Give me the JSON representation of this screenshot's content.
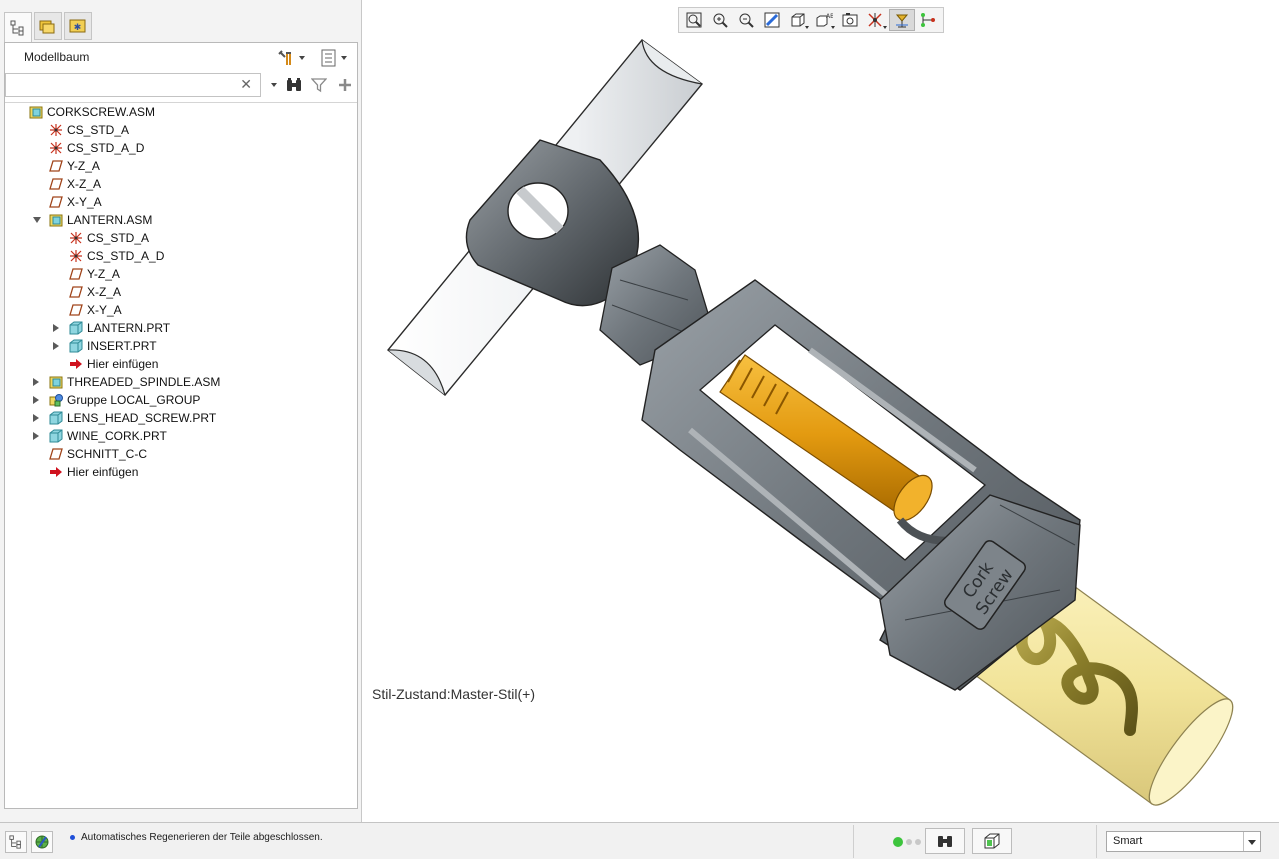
{
  "navigator": {
    "tabs": [
      {
        "name": "model-tree-tab-icon",
        "active": true
      },
      {
        "name": "folder-browser-tab-icon",
        "active": false
      },
      {
        "name": "favorites-tab-icon",
        "active": false
      }
    ],
    "title": "Modellbaum",
    "search": {
      "value": "",
      "placeholder": ""
    },
    "tree": [
      {
        "label": "CORKSCREW.ASM",
        "icon": "assembly",
        "level": 0,
        "expander": "none"
      },
      {
        "label": "CS_STD_A",
        "icon": "csys",
        "level": 1,
        "expander": "none"
      },
      {
        "label": "CS_STD_A_D",
        "icon": "csys",
        "level": 1,
        "expander": "none"
      },
      {
        "label": "Y-Z_A",
        "icon": "datum-plane",
        "level": 1,
        "expander": "none"
      },
      {
        "label": "X-Z_A",
        "icon": "datum-plane",
        "level": 1,
        "expander": "none"
      },
      {
        "label": "X-Y_A",
        "icon": "datum-plane",
        "level": 1,
        "expander": "none"
      },
      {
        "label": "LANTERN.ASM",
        "icon": "assembly",
        "level": 1,
        "expander": "expanded"
      },
      {
        "label": "CS_STD_A",
        "icon": "csys",
        "level": 2,
        "expander": "none"
      },
      {
        "label": "CS_STD_A_D",
        "icon": "csys",
        "level": 2,
        "expander": "none"
      },
      {
        "label": "Y-Z_A",
        "icon": "datum-plane",
        "level": 2,
        "expander": "none"
      },
      {
        "label": "X-Z_A",
        "icon": "datum-plane",
        "level": 2,
        "expander": "none"
      },
      {
        "label": "X-Y_A",
        "icon": "datum-plane",
        "level": 2,
        "expander": "none"
      },
      {
        "label": "LANTERN.PRT",
        "icon": "part",
        "level": 2,
        "expander": "collapsed"
      },
      {
        "label": "INSERT.PRT",
        "icon": "part",
        "level": 2,
        "expander": "collapsed"
      },
      {
        "label": "Hier einfügen",
        "icon": "insert-here",
        "level": 2,
        "expander": "none"
      },
      {
        "label": "THREADED_SPINDLE.ASM",
        "icon": "assembly",
        "level": 1,
        "expander": "collapsed"
      },
      {
        "label": "Gruppe LOCAL_GROUP",
        "icon": "group",
        "level": 1,
        "expander": "collapsed"
      },
      {
        "label": "LENS_HEAD_SCREW.PRT",
        "icon": "part",
        "level": 1,
        "expander": "collapsed"
      },
      {
        "label": "WINE_CORK.PRT",
        "icon": "part",
        "level": 1,
        "expander": "collapsed"
      },
      {
        "label": "SCHNITT_C-C",
        "icon": "datum-plane",
        "level": 1,
        "expander": "none"
      },
      {
        "label": "Hier einfügen",
        "icon": "insert-here",
        "level": 1,
        "expander": "none"
      }
    ]
  },
  "viewport": {
    "style_state": "Stil-Zustand:Master-Stil(+)",
    "toolbar": [
      {
        "name": "refit-icon",
        "pressed": false,
        "dropdown": false
      },
      {
        "name": "zoom-in-icon",
        "pressed": false,
        "dropdown": false
      },
      {
        "name": "zoom-out-icon",
        "pressed": false,
        "dropdown": false
      },
      {
        "name": "repaint-icon",
        "pressed": false,
        "dropdown": false
      },
      {
        "name": "display-style-icon",
        "pressed": false,
        "dropdown": true
      },
      {
        "name": "saved-orientations-icon",
        "pressed": false,
        "dropdown": true
      },
      {
        "name": "view-manager-icon",
        "pressed": false,
        "dropdown": false
      },
      {
        "name": "datum-display-icon",
        "pressed": false,
        "dropdown": true
      },
      {
        "name": "spin-center-icon",
        "pressed": true,
        "dropdown": false
      },
      {
        "name": "annotation-display-icon",
        "pressed": false,
        "dropdown": false
      }
    ]
  },
  "colors": {
    "metal": "#6f767c",
    "spindle": "#e39a10",
    "cork": "#f2e49a",
    "handle": "#f2f3f4",
    "helix": "#8a7d2a"
  },
  "status_bar": {
    "message": "Automatisches Regenerieren der Teile abgeschlossen.",
    "filter": {
      "value": "Smart"
    }
  }
}
